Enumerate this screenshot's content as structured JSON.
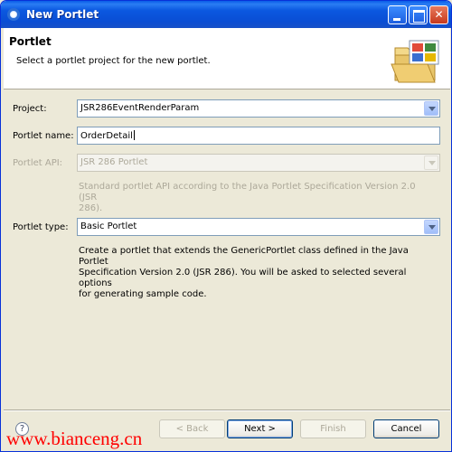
{
  "window": {
    "title": "New Portlet"
  },
  "header": {
    "title": "Portlet",
    "description": "Select a portlet project for the new portlet."
  },
  "form": {
    "project": {
      "label": "Project:",
      "value": "JSR286EventRenderParam"
    },
    "portlet_name": {
      "label": "Portlet name:",
      "value": "OrderDetail"
    },
    "portlet_api": {
      "label": "Portlet API:",
      "value": "JSR 286 Portlet",
      "enabled": false,
      "description_line1": "Standard portlet API according to the Java Portlet Specification Version 2.0 (JSR",
      "description_line2": "286)."
    },
    "portlet_type": {
      "label": "Portlet type:",
      "value": "Basic Portlet",
      "description_line1": "Create a portlet that extends the GenericPortlet class defined in the Java Portlet",
      "description_line2": "Specification Version 2.0 (JSR 286).  You will be asked to selected several options",
      "description_line3": "for generating sample code."
    }
  },
  "buttons": {
    "back": "< Back",
    "next": "Next >",
    "finish": "Finish",
    "cancel": "Cancel"
  },
  "help_symbol": "?",
  "watermark": "www.bianceng.cn",
  "colors": {
    "titlebar": "#0a4ed4",
    "dialog_background": "#ece9d8",
    "watermark": "#ff0000",
    "disabled_text": "#aca899"
  }
}
